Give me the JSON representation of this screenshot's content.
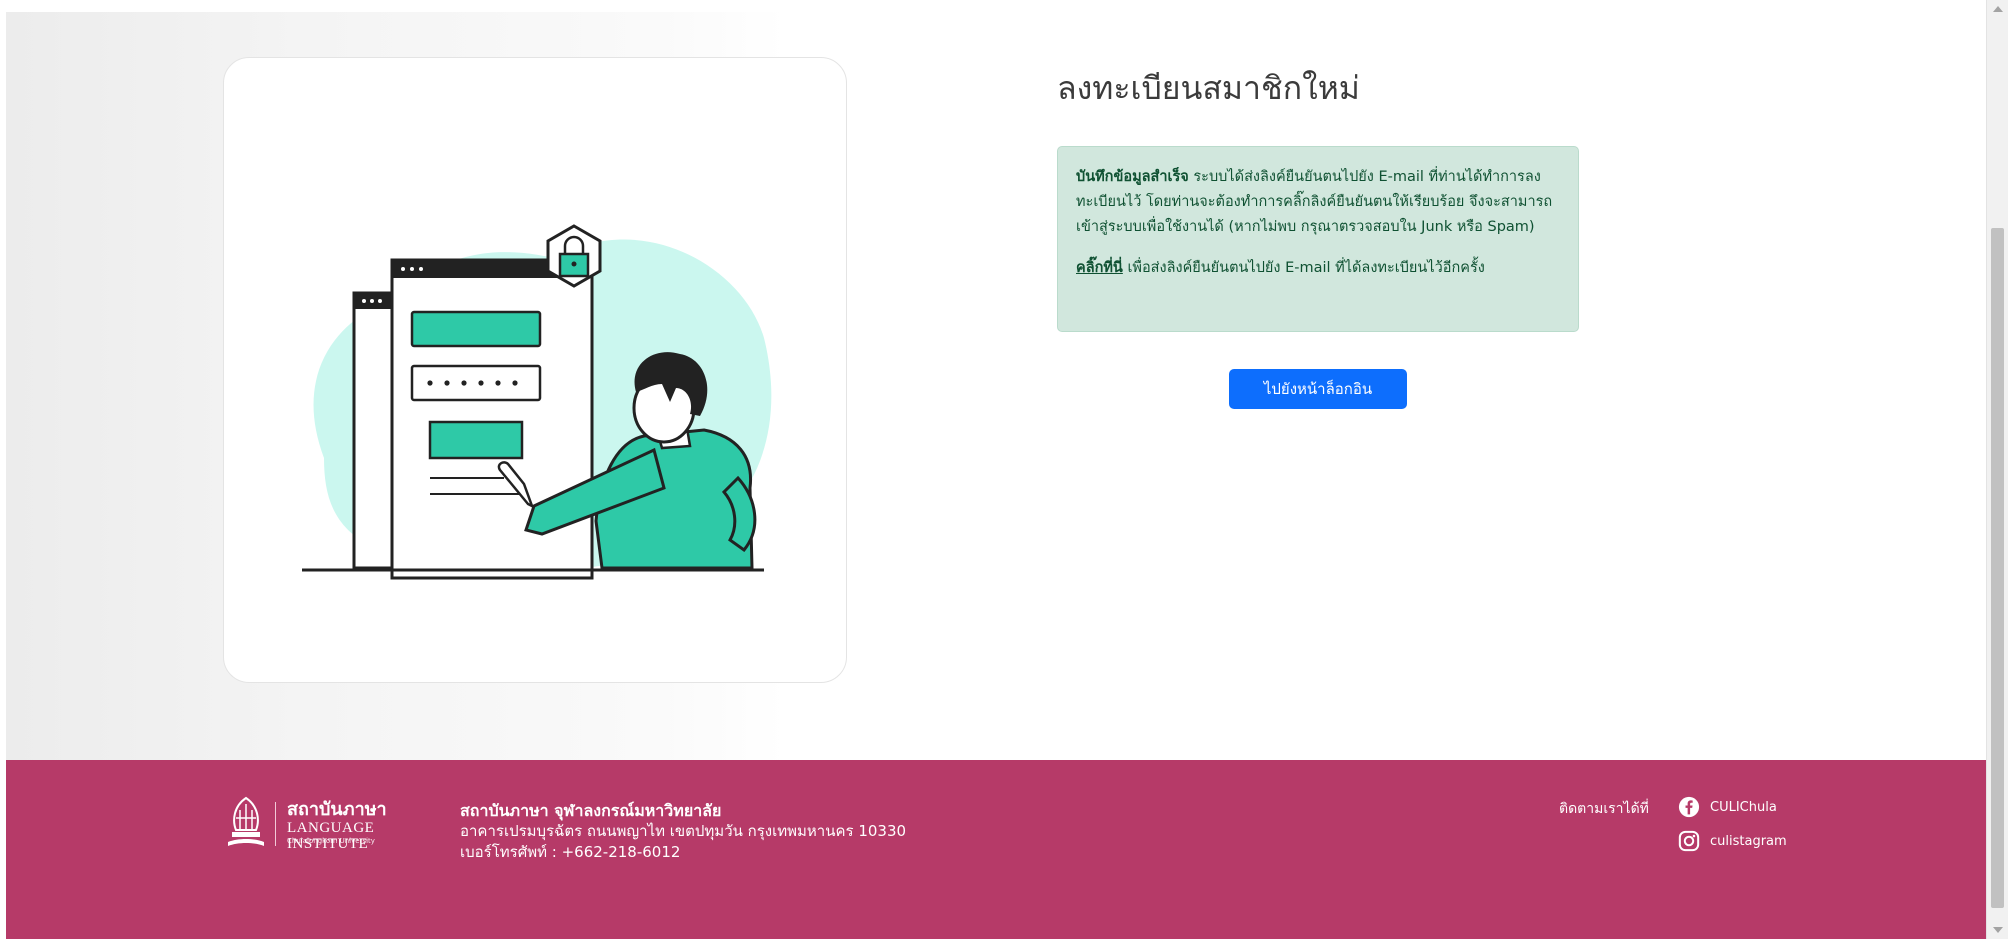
{
  "main": {
    "title": "ลงทะเบียนสมาชิกใหม่",
    "alert": {
      "bold_prefix": "บันทึกข้อมูลสำเร็จ",
      "message": " ระบบได้ส่งลิงค์ยืนยันตนไปยัง E-mail ที่ท่านได้ทำการลงทะเบียนไว้ โดยท่านจะต้องทำการคลิ๊กลิงค์ยืนยันตนให้เรียบร้อย จึงจะสามารถเข้าสู่ระบบเพื่อใช้งานได้ (หากไม่พบ กรุณาตรวจสอบใน Junk หรือ Spam)",
      "resend_link": "คลิ๊กที่นี่",
      "resend_text": " เพื่อส่งลิงค์ยืนยันตนไปยัง E-mail ที่ได้ลงทะเบียนไว้อีกครั้ง"
    },
    "login_button": "ไปยังหน้าล็อกอิน",
    "illustration_icons": [
      "lock-icon",
      "password-dots",
      "pointing-hand"
    ]
  },
  "footer": {
    "logo": {
      "thai": "สถาบันภาษา",
      "english": "LANGUAGE INSTITUTE",
      "sub": "Chulalongkorn University"
    },
    "org_name": "สถาบันภาษา จุฬาลงกรณ์มหาวิทยาลัย",
    "address": "อาคารเปรมบุรฉัตร ถนนพญาไท เขตปทุมวัน กรุงเทพมหานคร 10330",
    "phone": "เบอร์โทรศัพท์ : +662-218-6012",
    "follow_label": "ติดตามเราได้ที่",
    "facebook": "CULIChula",
    "instagram": "culistagram"
  },
  "colors": {
    "footer_bg": "#b63a68",
    "button_bg": "#0d6efd",
    "alert_bg": "#d1e7dd",
    "illustration_accent": "#2ec9a7",
    "illustration_blob": "#cbf7ef"
  }
}
